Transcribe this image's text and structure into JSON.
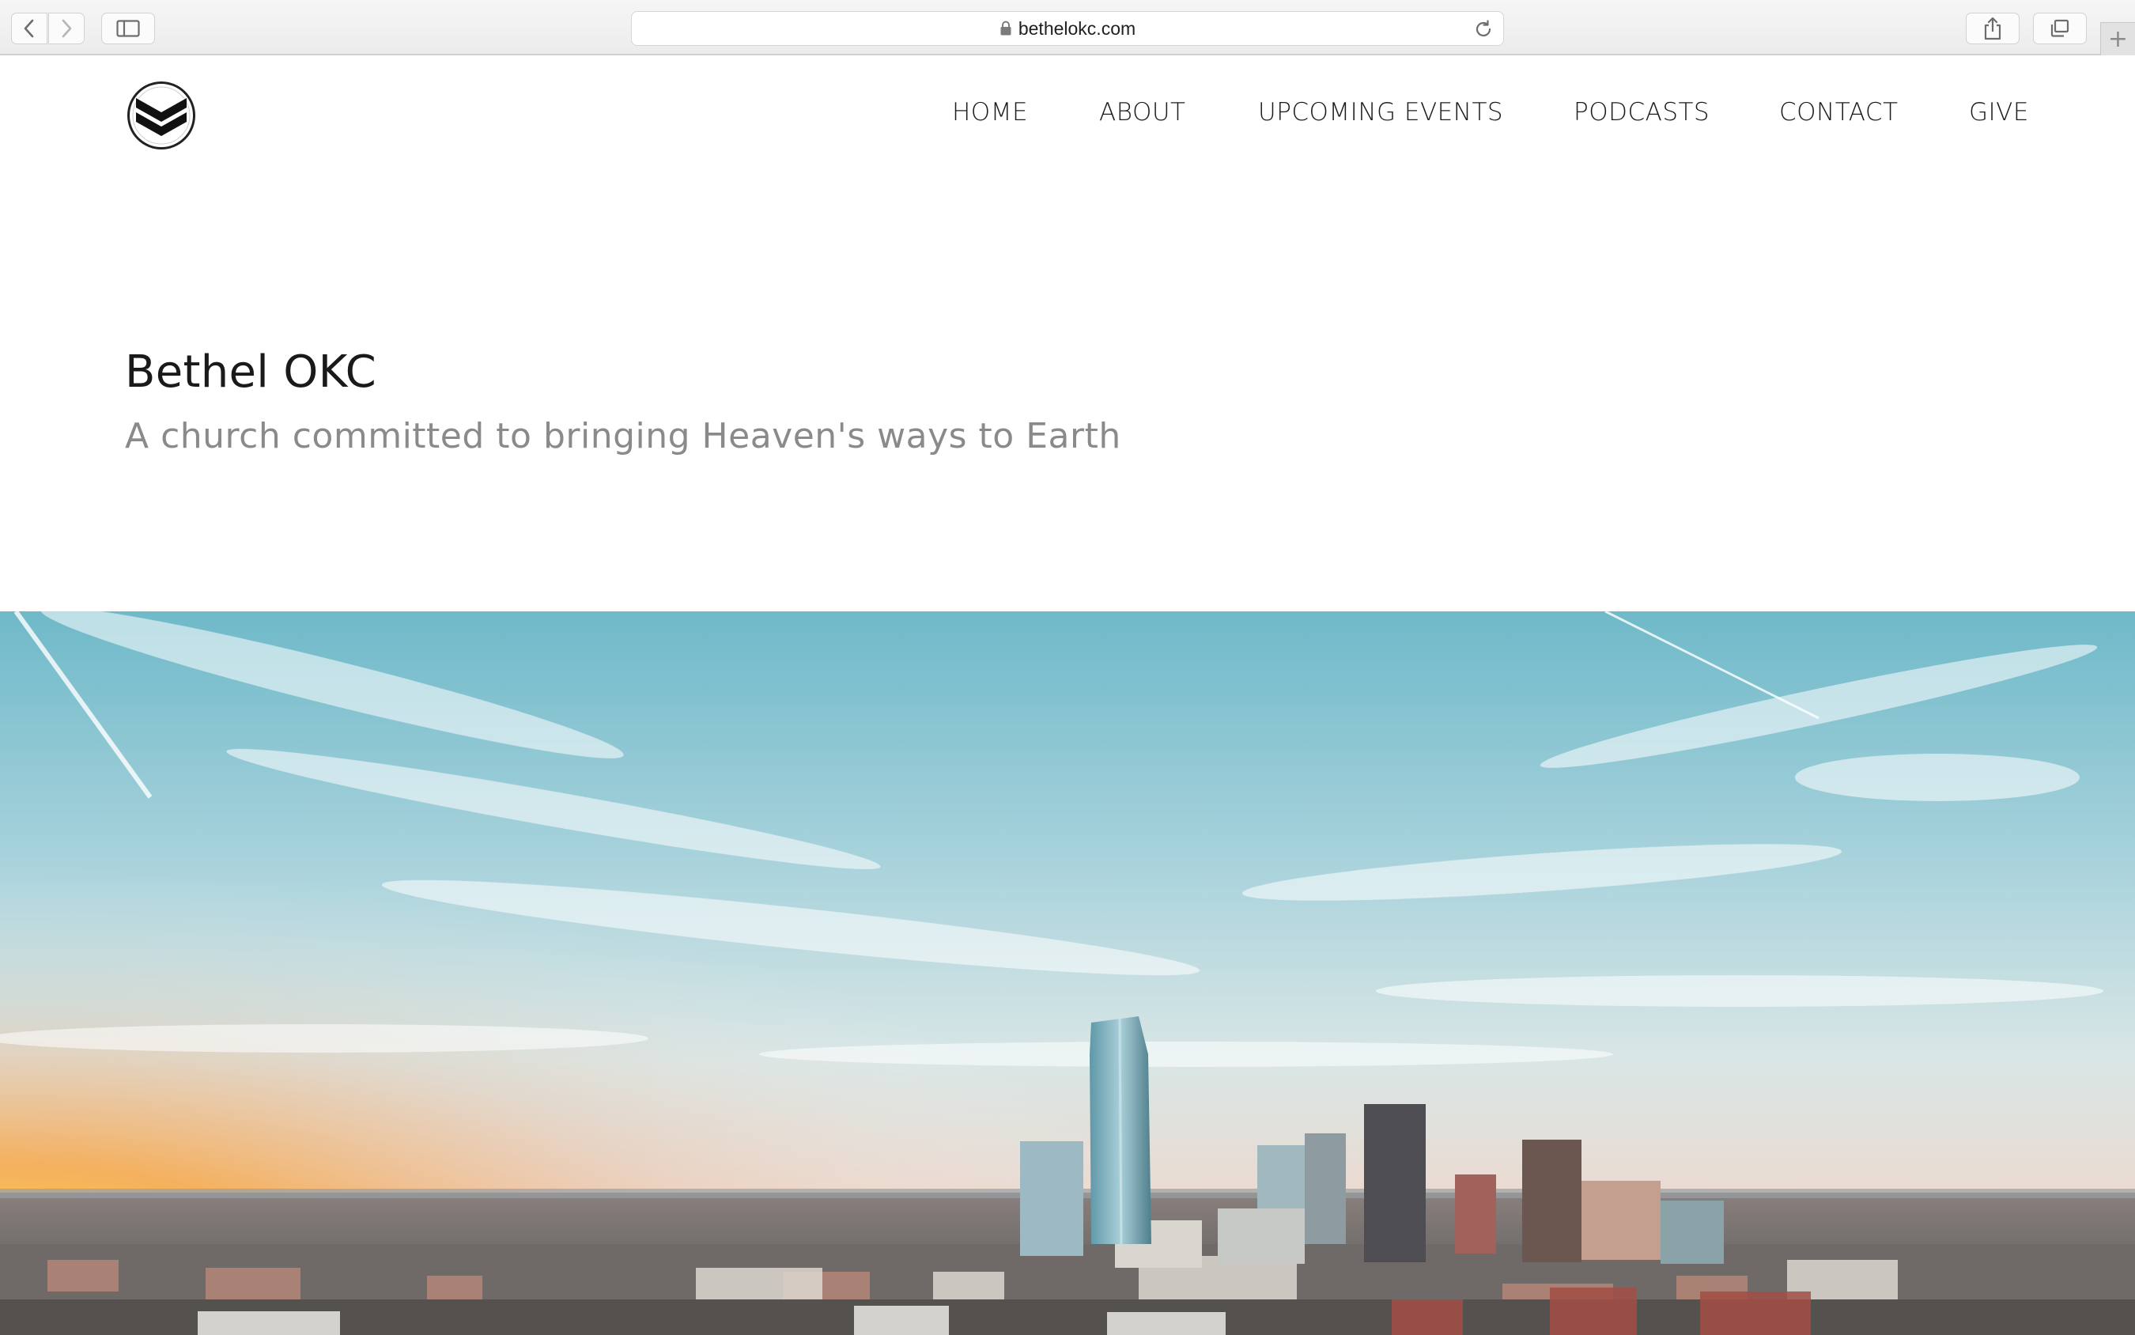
{
  "browser": {
    "url": "bethelokc.com",
    "back_icon": "chevron-left-icon",
    "forward_icon": "chevron-right-icon",
    "sidebar_icon": "sidebar-icon",
    "reload_icon": "reload-icon",
    "share_icon": "share-icon",
    "tabs_icon": "tabs-overview-icon",
    "new_tab_label": "+"
  },
  "site": {
    "logo_icon": "chevron-stack-icon",
    "nav": [
      {
        "label": "HOME"
      },
      {
        "label": "ABOUT"
      },
      {
        "label": "UPCOMING EVENTS"
      },
      {
        "label": "PODCASTS"
      },
      {
        "label": "CONTACT"
      },
      {
        "label": "GIVE"
      }
    ],
    "title": "Bethel OKC",
    "tagline": "A church committed to bringing Heaven's ways to Earth"
  },
  "colors": {
    "title": "#1a1a1a",
    "tagline": "#8a8a8a",
    "sky_top": "#6fb9c9",
    "sunset": "#f2a33a"
  }
}
